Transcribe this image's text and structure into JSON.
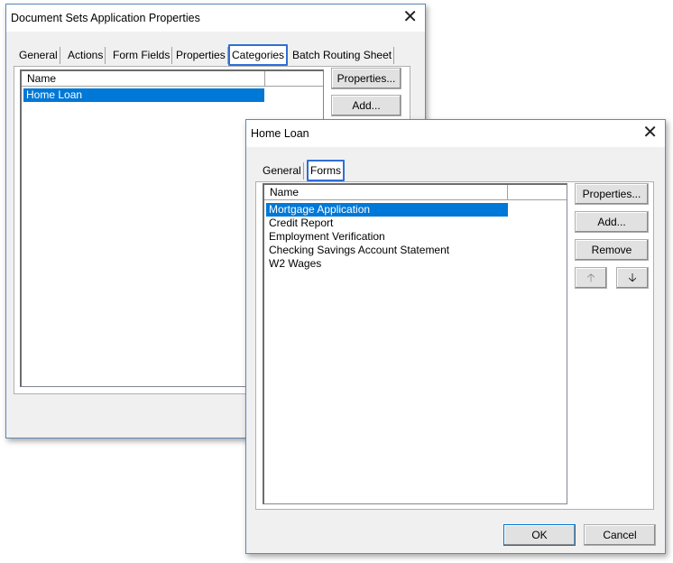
{
  "back_dialog": {
    "title": "Document Sets Application Properties",
    "close_glyph": "✕",
    "tabs": [
      "General",
      "Actions",
      "Form Fields",
      "Properties",
      "Categories",
      "Batch Routing Sheet"
    ],
    "active_tab": "Categories",
    "list": {
      "column_header": "Name",
      "items": [
        "Home Loan"
      ],
      "selected": "Home Loan"
    },
    "buttons": {
      "properties": "Properties...",
      "add": "Add..."
    }
  },
  "front_dialog": {
    "title": "Home Loan",
    "close_glyph": "✕",
    "tabs": [
      "General",
      "Forms"
    ],
    "active_tab": "Forms",
    "list": {
      "column_header": "Name",
      "items": [
        "Mortgage Application",
        "Credit Report",
        "Employment Verification",
        "Checking Savings Account Statement",
        "W2 Wages"
      ],
      "selected": "Mortgage Application"
    },
    "buttons": {
      "properties": "Properties...",
      "add": "Add...",
      "remove": "Remove",
      "move_up_glyph": "🡡",
      "move_down_glyph": "🡣",
      "ok": "OK",
      "cancel": "Cancel"
    }
  },
  "colors": {
    "selection": "#0078d7",
    "highlight_border": "#2f6fd4"
  }
}
